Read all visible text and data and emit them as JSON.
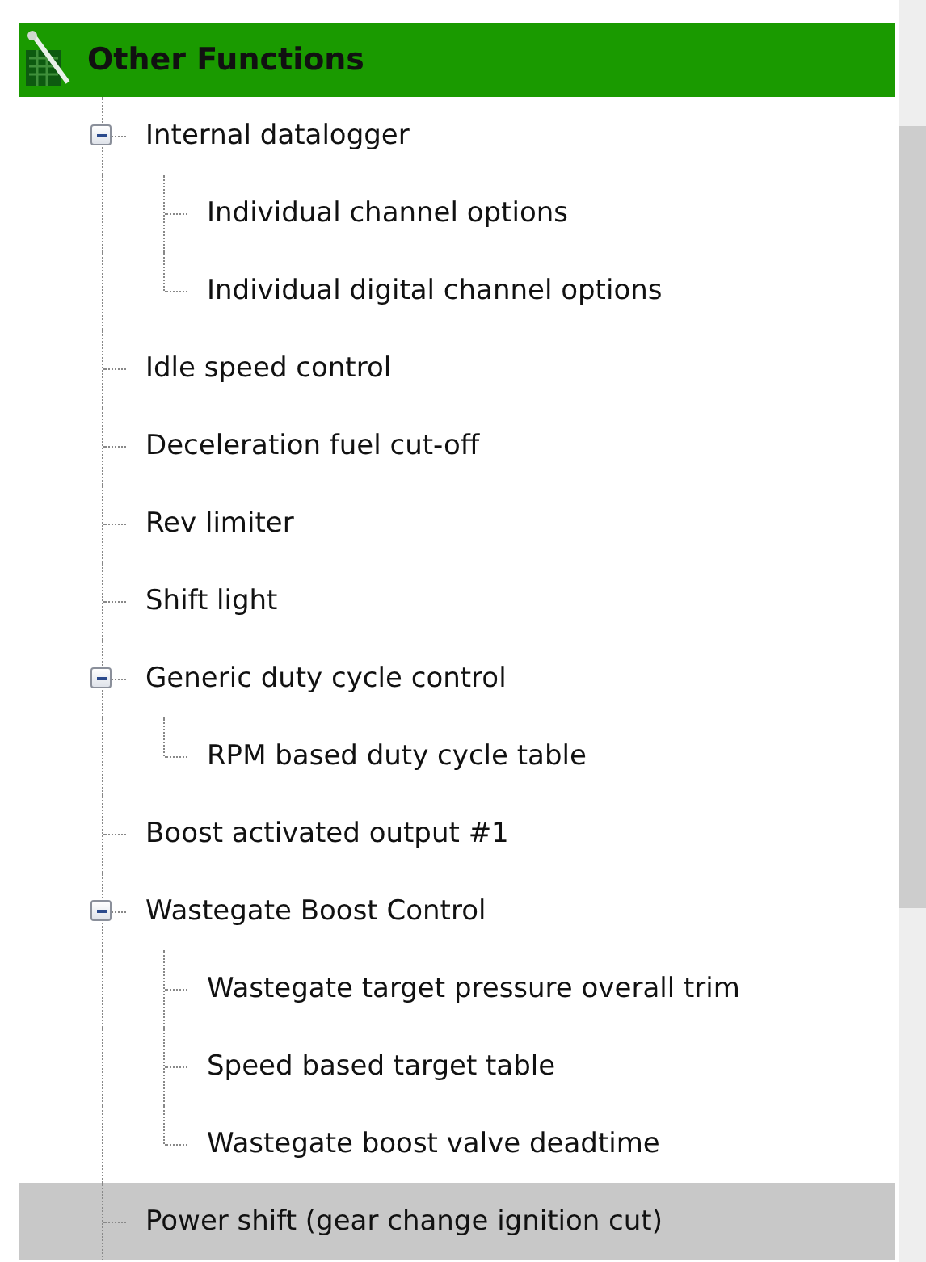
{
  "header": {
    "title": "Other Functions"
  },
  "tree": [
    {
      "label": "Internal datalogger",
      "selected": false,
      "expanded": true,
      "children": [
        {
          "label": "Individual channel options",
          "selected": false
        },
        {
          "label": "Individual digital channel options",
          "selected": false
        }
      ]
    },
    {
      "label": "Idle speed control",
      "selected": false
    },
    {
      "label": "Deceleration fuel cut-off",
      "selected": false
    },
    {
      "label": "Rev limiter",
      "selected": false
    },
    {
      "label": "Shift light",
      "selected": false
    },
    {
      "label": "Generic duty cycle control",
      "selected": false,
      "expanded": true,
      "children": [
        {
          "label": "RPM based duty cycle table",
          "selected": false
        }
      ]
    },
    {
      "label": "Boost activated output #1",
      "selected": false
    },
    {
      "label": "Wastegate Boost Control",
      "selected": false,
      "expanded": true,
      "children": [
        {
          "label": "Wastegate target pressure overall trim",
          "selected": false
        },
        {
          "label": "Speed based target table",
          "selected": false
        },
        {
          "label": "Wastegate boost valve deadtime",
          "selected": false
        }
      ]
    },
    {
      "label": "Power shift (gear change ignition cut)",
      "selected": true
    }
  ]
}
